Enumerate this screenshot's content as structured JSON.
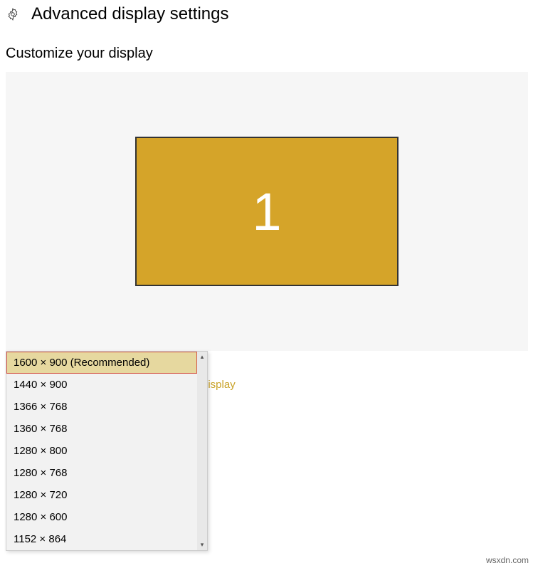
{
  "header": {
    "title": "Advanced display settings"
  },
  "subtitle": "Customize your display",
  "monitor": {
    "number": "1"
  },
  "link": {
    "partial_text": "display"
  },
  "resolution_dropdown": {
    "items": [
      "1600 × 900 (Recommended)",
      "1440 × 900",
      "1366 × 768",
      "1360 × 768",
      "1280 × 800",
      "1280 × 768",
      "1280 × 720",
      "1280 × 600",
      "1152 × 864"
    ]
  },
  "watermark": "wsxdn.com"
}
